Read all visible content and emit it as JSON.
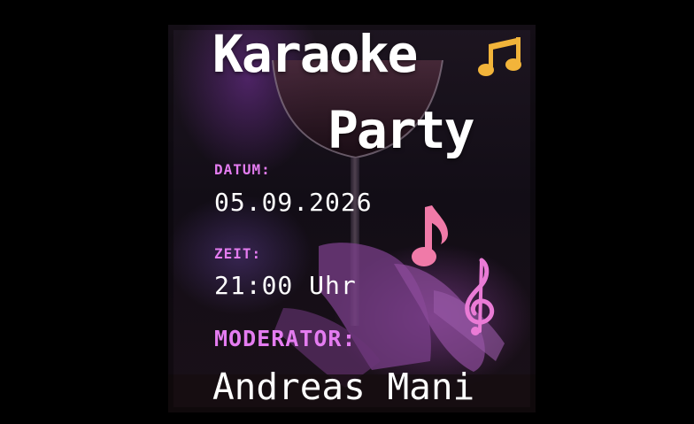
{
  "poster": {
    "title_line1": "Karaoke",
    "title_line2": "Party",
    "date_label": "DATUM:",
    "date_value": "05.09.2026",
    "time_label": "ZEIT:",
    "time_value": "21:00 Uhr",
    "moderator_label": "MODERATOR:",
    "moderator_value": "Andreas Mani"
  },
  "icons": {
    "title_note": "beamed-eighth-notes-icon",
    "pink_note": "eighth-note-icon",
    "treble_clef": "treble-clef-icon"
  },
  "colors": {
    "background": "#000000",
    "accent_label": "#e47cf0",
    "text": "#ffffff",
    "note_gold": "#f2b43a",
    "note_pink": "#f07aa8"
  }
}
